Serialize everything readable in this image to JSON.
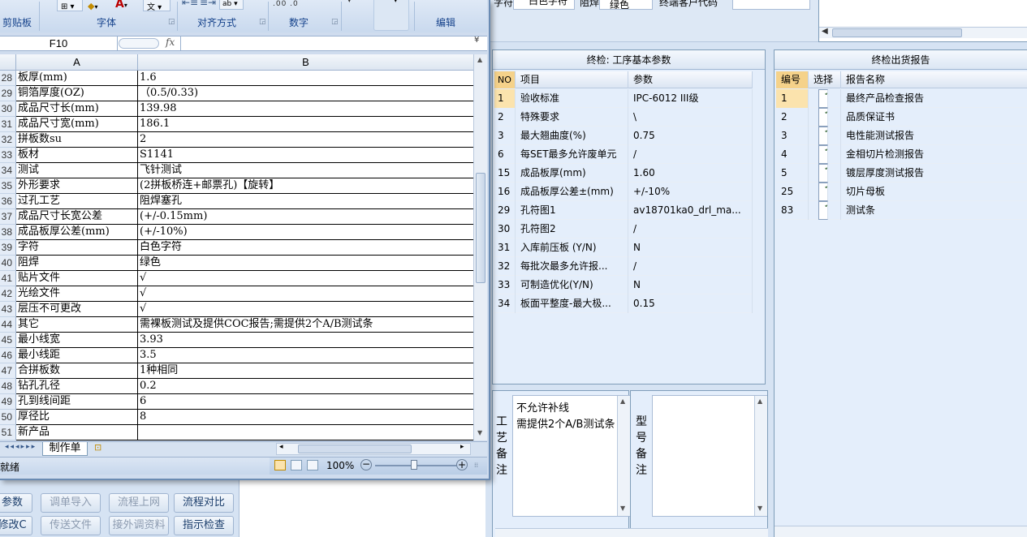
{
  "background_app": {
    "top_fields": {
      "zifu_label": "字符",
      "zifu_value": "白色字符",
      "zuhan_label": "阻焊",
      "zuhan_value": "绿色",
      "customer_code_label": "终端客户代码",
      "customer_code_value": ""
    },
    "params_panel": {
      "title": "终检: 工序基本参数",
      "columns": [
        "NO",
        "项目",
        "参数"
      ],
      "rows": [
        {
          "no": "1",
          "item": "验收标准",
          "value": "IPC-6012 III级"
        },
        {
          "no": "2",
          "item": "特殊要求",
          "value": "\\"
        },
        {
          "no": "3",
          "item": "最大翘曲度(%)",
          "value": "0.75"
        },
        {
          "no": "6",
          "item": "每SET最多允许废单元",
          "value": "/"
        },
        {
          "no": "15",
          "item": "成品板厚(mm)",
          "value": "1.60"
        },
        {
          "no": "16",
          "item": "成品板厚公差±(mm)",
          "value": "+/-10%"
        },
        {
          "no": "29",
          "item": "孔符图1",
          "value": "av18701ka0_drl_ma..."
        },
        {
          "no": "30",
          "item": "孔符图2",
          "value": "/"
        },
        {
          "no": "31",
          "item": "入库前压板 (Y/N)",
          "value": "N"
        },
        {
          "no": "32",
          "item": "每批次最多允许报...",
          "value": "/"
        },
        {
          "no": "33",
          "item": "可制造优化(Y/N)",
          "value": "N"
        },
        {
          "no": "34",
          "item": "板面平整度-最大极...",
          "value": "0.15"
        }
      ]
    },
    "reports_panel": {
      "title": "终检出货报告",
      "columns": [
        "编号",
        "选择",
        "报告名称"
      ],
      "rows": [
        {
          "no": "1",
          "checked": true,
          "name": "最终产品检查报告"
        },
        {
          "no": "2",
          "checked": true,
          "name": "品质保证书"
        },
        {
          "no": "3",
          "checked": true,
          "name": "电性能测试报告"
        },
        {
          "no": "4",
          "checked": true,
          "name": "金相切片检测报告"
        },
        {
          "no": "5",
          "checked": true,
          "name": "镀层厚度测试报告"
        },
        {
          "no": "25",
          "checked": true,
          "name": "切片母板"
        },
        {
          "no": "83",
          "checked": true,
          "name": "测试条"
        }
      ]
    },
    "process_note": {
      "label": "工艺备注",
      "text": "不允许补线\n需提供2个A/B测试条"
    },
    "model_note": {
      "label": "型号备注",
      "text": ""
    },
    "buttons": {
      "row1": [
        "参数",
        "调单导入",
        "流程上网",
        "流程对比"
      ],
      "row2": [
        "修改C",
        "传送文件",
        "接外调资料",
        "指示检查"
      ]
    }
  },
  "excel": {
    "ribbon_groups": [
      "剪贴板",
      "字体",
      "对齐方式",
      "数字",
      "编辑"
    ],
    "name_box": "F10",
    "fx_label": "fx",
    "formula": "",
    "col_headers": [
      "A",
      "B"
    ],
    "rows": [
      {
        "num": "28",
        "a": "板厚(mm)",
        "b": "1.6"
      },
      {
        "num": "29",
        "a": "铜箔厚度(OZ)",
        "b": "（0.5/0.33)"
      },
      {
        "num": "30",
        "a": "成品尺寸长(mm)",
        "b": "139.98"
      },
      {
        "num": "31",
        "a": "成品尺寸宽(mm)",
        "b": "186.1"
      },
      {
        "num": "32",
        "a": "拼板数su",
        "b": "2"
      },
      {
        "num": "33",
        "a": "板材",
        "b": "S1141"
      },
      {
        "num": "34",
        "a": "测试",
        "b": "飞针测试"
      },
      {
        "num": "35",
        "a": "外形要求",
        "b": "(2拼板桥连+邮票孔)【旋转】"
      },
      {
        "num": "36",
        "a": "过孔工艺",
        "b": "阻焊塞孔"
      },
      {
        "num": "37",
        "a": "成品尺寸长宽公差",
        "b": "(+/-0.15mm)"
      },
      {
        "num": "38",
        "a": "成品板厚公差(mm)",
        "b": "(+/-10%)"
      },
      {
        "num": "39",
        "a": "字符",
        "b": "白色字符"
      },
      {
        "num": "40",
        "a": "阻焊",
        "b": "绿色"
      },
      {
        "num": "41",
        "a": "贴片文件",
        "b": "√"
      },
      {
        "num": "42",
        "a": "光绘文件",
        "b": "√"
      },
      {
        "num": "43",
        "a": "层压不可更改",
        "b": "√"
      },
      {
        "num": "44",
        "a": "其它",
        "b": "需裸板测试及提供COC报告;需提供2个A/B测试条"
      },
      {
        "num": "45",
        "a": "最小线宽",
        "b": "3.93"
      },
      {
        "num": "46",
        "a": "最小线距",
        "b": "3.5"
      },
      {
        "num": "47",
        "a": "合拼板数",
        "b": "1种相同"
      },
      {
        "num": "48",
        "a": "钻孔孔径",
        "b": "0.2"
      },
      {
        "num": "49",
        "a": "孔到线间距",
        "b": "6"
      },
      {
        "num": "50",
        "a": "厚径比",
        "b": "8"
      },
      {
        "num": "51",
        "a": "新产品",
        "b": ""
      }
    ],
    "sheet_tab": "制作单",
    "status": "就绪",
    "zoom": "100%"
  }
}
